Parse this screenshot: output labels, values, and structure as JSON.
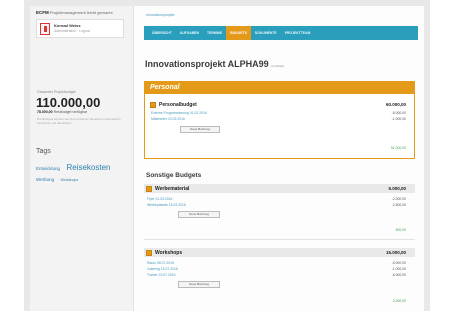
{
  "app": {
    "logo_name": "ECFM",
    "logo_tagline": "Projektmanagement leicht gemacht"
  },
  "user": {
    "name": "Konrad Weiss",
    "subtitle": "Administration · Logout"
  },
  "sidebar": {
    "budget_label": "Gesamtes Projektbudget",
    "budget_total": "110.000,00",
    "budget_rest_value": "78.000,00",
    "budget_rest_label": "Restbudget verfügbar",
    "budget_note": "Die Budgets werden aus den einzelnen Bereichen automatisch berechnet und aktualisiert.",
    "tags_title": "Tags",
    "tags": [
      {
        "label": "Entwicklung",
        "size": "normal"
      },
      {
        "label": "Reisekosten",
        "size": "big"
      },
      {
        "label": "Werbung",
        "size": "normal"
      },
      {
        "label": "Workshops",
        "size": "small"
      }
    ]
  },
  "breadcrumb": "Innovationsprojekt",
  "nav": {
    "items": [
      {
        "label": "ÜBERSICHT",
        "active": false
      },
      {
        "label": "AUFGABEN",
        "active": false
      },
      {
        "label": "TERMINE",
        "active": false
      },
      {
        "label": "BUDGETS",
        "active": true
      },
      {
        "label": "DOKUMENTE",
        "active": false
      },
      {
        "label": "PROJEKTTEAM",
        "active": false
      }
    ]
  },
  "main": {
    "title": "Innovationsprojekt ALPHA99",
    "title_note": "(in Arbeit)",
    "personal": {
      "heading": "Personal",
      "budget_title": "Personalbudget",
      "budget_amount": "60.000,00",
      "lines": [
        {
          "label": "Externe Programmierung  01.02.2016",
          "amount": "-8.000,00"
        },
        {
          "label": "Mitarbeiter  23.03.2016",
          "amount": "-1.000,00"
        }
      ],
      "button": "Neue Buchung",
      "rest": "51.000,00"
    },
    "other_title": "Sonstige Budgets",
    "werbematerial": {
      "title": "Werbematerial",
      "amount": "5.000,00",
      "lines": [
        {
          "label": "Flyer  01.03.2016",
          "amount": "-2.000,00"
        },
        {
          "label": "Werbeplakate  15.03.2016",
          "amount": "-2.500,00"
        }
      ],
      "button": "Neue Buchung",
      "rest": "500,00"
    },
    "workshops": {
      "title": "Workshops",
      "amount": "15.000,00",
      "lines": [
        {
          "label": "Raum  08.07.2016",
          "amount": "-5.000,00"
        },
        {
          "label": "Catering  15.07.2016",
          "amount": "-1.000,00"
        },
        {
          "label": "Trainer  20.07.2016",
          "amount": "-6.000,00"
        }
      ],
      "button": "Neue Buchung",
      "rest": "3.000,00"
    }
  }
}
